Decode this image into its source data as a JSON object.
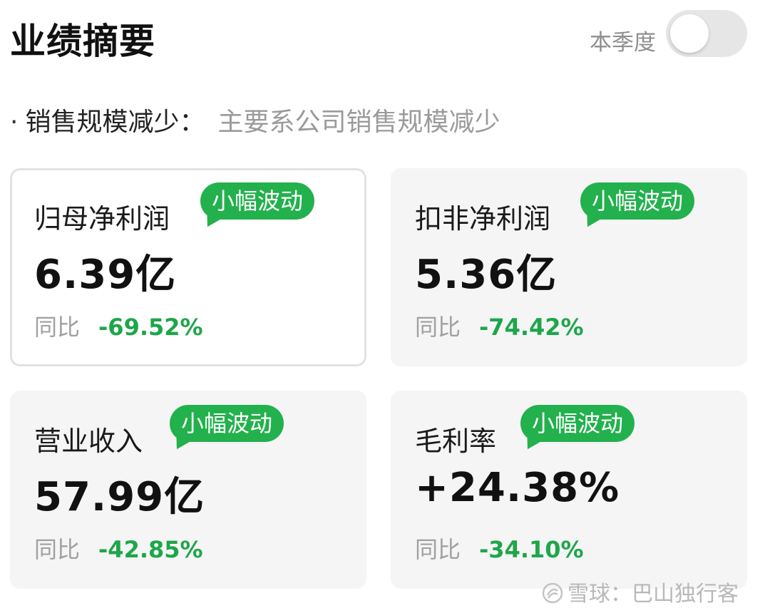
{
  "header": {
    "title": "业绩摘要",
    "period_label": "本季度",
    "toggle_on": false
  },
  "summary": {
    "bullet": "·",
    "key": "销售规模减少：",
    "value": "主要系公司销售规模减少"
  },
  "cards": [
    {
      "name": "归母净利润",
      "badge": "小幅波动",
      "value": "6.39亿",
      "yoy_label": "同比",
      "yoy_value": "-69.52%",
      "selected": true
    },
    {
      "name": "扣非净利润",
      "badge": "小幅波动",
      "value": "5.36亿",
      "yoy_label": "同比",
      "yoy_value": "-74.42%",
      "selected": false
    },
    {
      "name": "营业收入",
      "badge": "小幅波动",
      "value": "57.99亿",
      "yoy_label": "同比",
      "yoy_value": "-42.85%",
      "selected": false
    },
    {
      "name": "毛利率",
      "badge": "小幅波动",
      "value": "+24.38%",
      "yoy_label": "同比",
      "yoy_value": "-34.10%",
      "selected": false
    }
  ],
  "watermark": {
    "text": "雪球：巴山独行客",
    "logo_icon": "snowball-logo"
  },
  "colors": {
    "badge_green": "#22b14c",
    "negative_green": "#1ea64a",
    "card_bg": "#f5f5f5"
  }
}
